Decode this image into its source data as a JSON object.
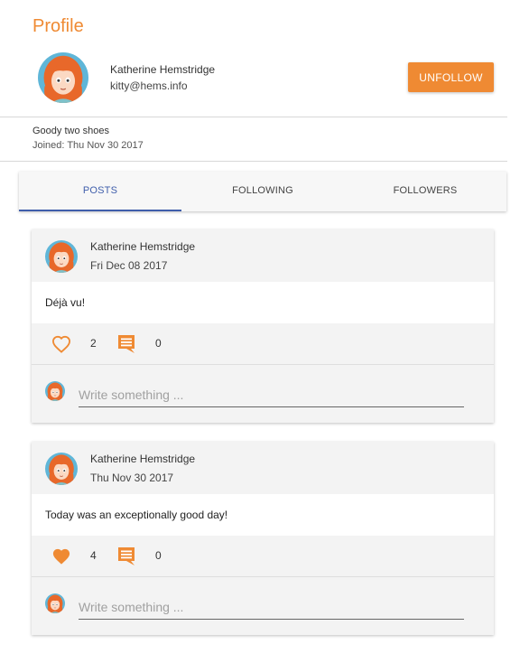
{
  "page": {
    "title": "Profile"
  },
  "profile": {
    "name": "Katherine Hemstridge",
    "email": "kitty@hems.info",
    "bio": "Goody two shoes",
    "joined": "Joined: Thu Nov 30 2017",
    "avatar_icon": "user-avatar"
  },
  "actions": {
    "unfollow_label": "UNFOLLOW"
  },
  "tabs": [
    {
      "label": "POSTS",
      "active": true
    },
    {
      "label": "FOLLOWING",
      "active": false
    },
    {
      "label": "FOLLOWERS",
      "active": false
    }
  ],
  "posts": [
    {
      "author": "Katherine Hemstridge",
      "date": "Fri Dec 08 2017",
      "text": "Déjà vu!",
      "likes": "2",
      "liked": false,
      "comments": "0",
      "comment_placeholder": "Write something ..."
    },
    {
      "author": "Katherine Hemstridge",
      "date": "Thu Nov 30 2017",
      "text": "Today was an exceptionally good day!",
      "likes": "4",
      "liked": true,
      "comments": "0",
      "comment_placeholder": "Write something ..."
    }
  ],
  "colors": {
    "accent": "#ef8a33",
    "tab_active": "#3f5eab",
    "panel_bg": "#f3f3f3"
  }
}
